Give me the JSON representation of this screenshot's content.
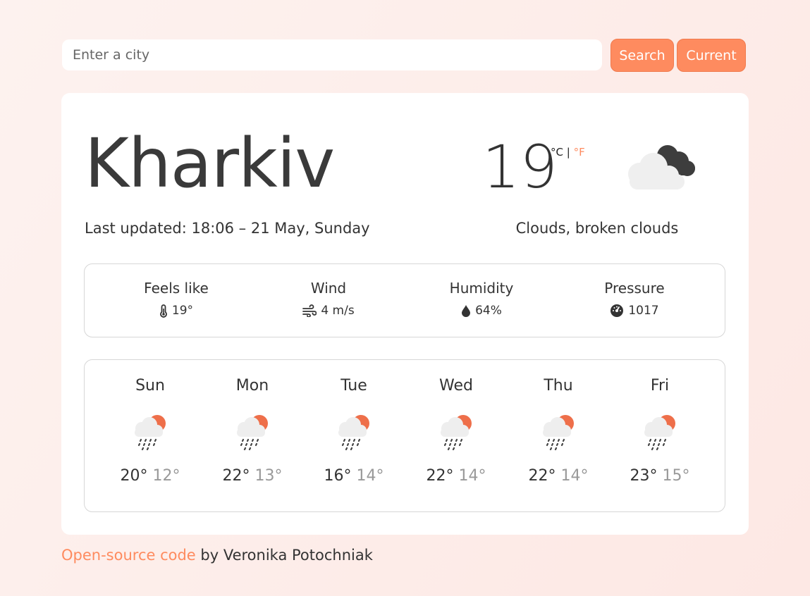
{
  "search": {
    "placeholder": "Enter a city",
    "search_label": "Search",
    "current_label": "Current"
  },
  "weather": {
    "city": "Kharkiv",
    "temperature": "19",
    "unit_c": "°C",
    "unit_sep": "|",
    "unit_f": "°F",
    "icon": "broken-clouds-icon",
    "last_updated": "Last updated: 18:06 – 21 May, Sunday",
    "description": "Clouds, broken clouds"
  },
  "details": [
    {
      "label": "Feels like",
      "value": "19°",
      "icon": "thermometer-icon"
    },
    {
      "label": "Wind",
      "value": "4 m/s",
      "icon": "wind-icon"
    },
    {
      "label": "Humidity",
      "value": "64%",
      "icon": "droplet-icon"
    },
    {
      "label": "Pressure",
      "value": "1017",
      "icon": "gauge-icon"
    }
  ],
  "forecast": [
    {
      "day": "Sun",
      "max": "20°",
      "min": "12°",
      "icon": "rain-sun-icon"
    },
    {
      "day": "Mon",
      "max": "22°",
      "min": "13°",
      "icon": "rain-sun-icon"
    },
    {
      "day": "Tue",
      "max": "16°",
      "min": "14°",
      "icon": "rain-sun-icon"
    },
    {
      "day": "Wed",
      "max": "22°",
      "min": "14°",
      "icon": "rain-sun-icon"
    },
    {
      "day": "Thu",
      "max": "22°",
      "min": "14°",
      "icon": "rain-sun-icon"
    },
    {
      "day": "Fri",
      "max": "23°",
      "min": "15°",
      "icon": "rain-sun-icon"
    }
  ],
  "footer": {
    "link_text": "Open-source code",
    "rest": " by Veronika Potochniak"
  },
  "colors": {
    "accent": "#fe8b5f",
    "muted": "#999999"
  }
}
